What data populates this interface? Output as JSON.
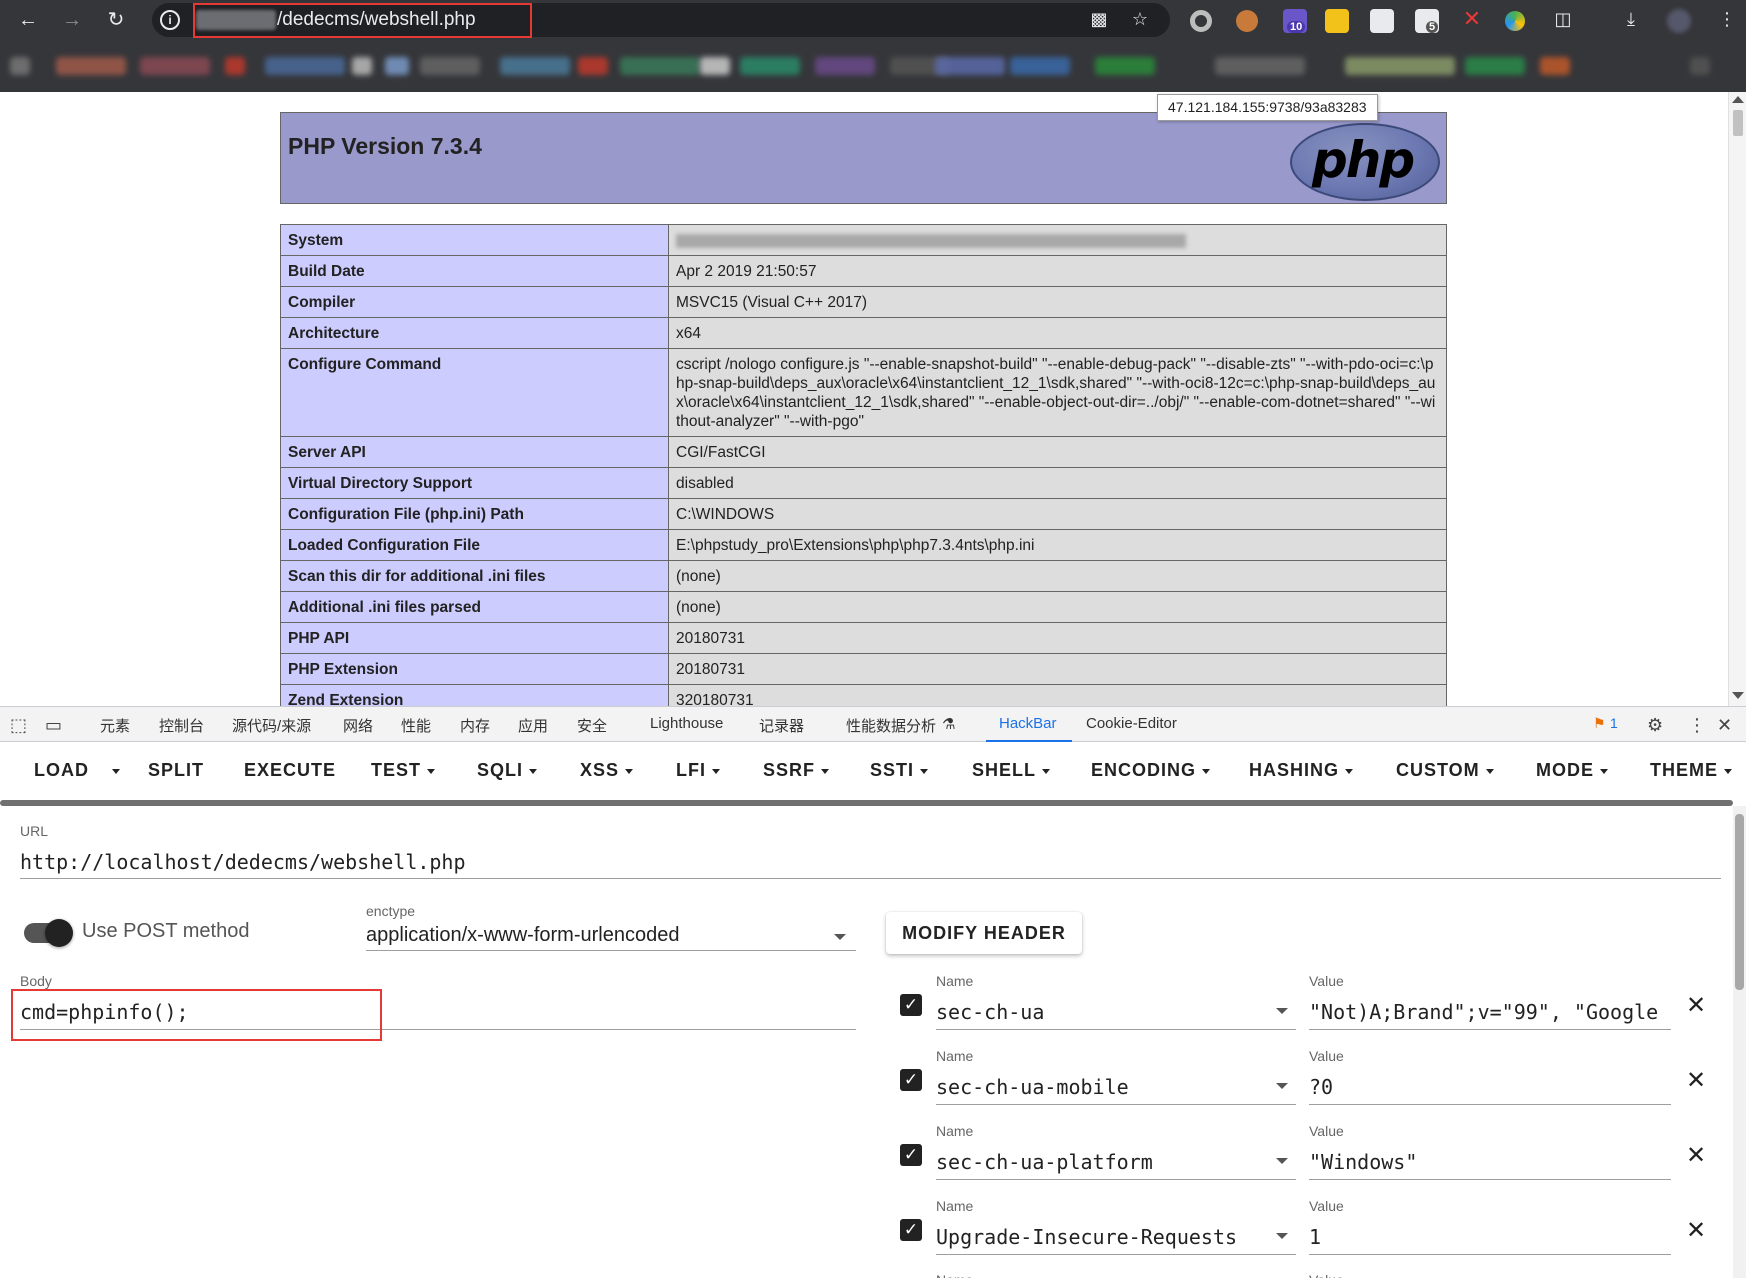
{
  "browser": {
    "url_visible": "/dedecms/webshell.php",
    "tooltip": "47.121.184.155:9738/93a83283",
    "extension_badges": [
      "10",
      "5"
    ]
  },
  "phpinfo": {
    "title": "PHP Version 7.3.4",
    "logo_text": "php",
    "rows": [
      {
        "key": "System",
        "value": ""
      },
      {
        "key": "Build Date",
        "value": "Apr 2 2019 21:50:57"
      },
      {
        "key": "Compiler",
        "value": "MSVC15 (Visual C++ 2017)"
      },
      {
        "key": "Architecture",
        "value": "x64"
      },
      {
        "key": "Configure Command",
        "value": "cscript /nologo configure.js \"--enable-snapshot-build\" \"--enable-debug-pack\" \"--disable-zts\" \"--with-pdo-oci=c:\\php-snap-build\\deps_aux\\oracle\\x64\\instantclient_12_1\\sdk,shared\" \"--with-oci8-12c=c:\\php-snap-build\\deps_aux\\oracle\\x64\\instantclient_12_1\\sdk,shared\" \"--enable-object-out-dir=../obj/\" \"--enable-com-dotnet=shared\" \"--without-analyzer\" \"--with-pgo\""
      },
      {
        "key": "Server API",
        "value": "CGI/FastCGI"
      },
      {
        "key": "Virtual Directory Support",
        "value": "disabled"
      },
      {
        "key": "Configuration File (php.ini) Path",
        "value": "C:\\WINDOWS"
      },
      {
        "key": "Loaded Configuration File",
        "value": "E:\\phpstudy_pro\\Extensions\\php\\php7.3.4nts\\php.ini"
      },
      {
        "key": "Scan this dir for additional .ini files",
        "value": "(none)"
      },
      {
        "key": "Additional .ini files parsed",
        "value": "(none)"
      },
      {
        "key": "PHP API",
        "value": "20180731"
      },
      {
        "key": "PHP Extension",
        "value": "20180731"
      },
      {
        "key": "Zend Extension",
        "value": "320180731"
      }
    ]
  },
  "devtools": {
    "tabs": [
      "元素",
      "控制台",
      "源代码/来源",
      "网络",
      "性能",
      "内存",
      "应用",
      "安全",
      "Lighthouse",
      "记录器",
      "性能数据分析",
      "HackBar",
      "Cookie-Editor"
    ],
    "active_tab": "HackBar",
    "issues_count": "1"
  },
  "hackbar": {
    "toolbar": [
      "LOAD",
      "SPLIT",
      "EXECUTE",
      "TEST",
      "SQLI",
      "XSS",
      "LFI",
      "SSRF",
      "SSTI",
      "SHELL",
      "ENCODING",
      "HASHING",
      "CUSTOM",
      "MODE",
      "THEME"
    ],
    "url_label": "URL",
    "url_value": "http://localhost/dedecms/webshell.php",
    "post_label": "Use POST method",
    "post_enabled": true,
    "enctype_label": "enctype",
    "enctype_value": "application/x-www-form-urlencoded",
    "modify_header_label": "MODIFY HEADER",
    "body_label": "Body",
    "body_value": "cmd=phpinfo();",
    "name_label": "Name",
    "value_label": "Value",
    "headers": [
      {
        "checked": true,
        "name": "sec-ch-ua",
        "value": "\"Not)A;Brand\";v=\"99\", \"Google"
      },
      {
        "checked": true,
        "name": "sec-ch-ua-mobile",
        "value": "?0"
      },
      {
        "checked": true,
        "name": "sec-ch-ua-platform",
        "value": "\"Windows\""
      },
      {
        "checked": true,
        "name": "Upgrade-Insecure-Requests",
        "value": "1"
      }
    ]
  }
}
